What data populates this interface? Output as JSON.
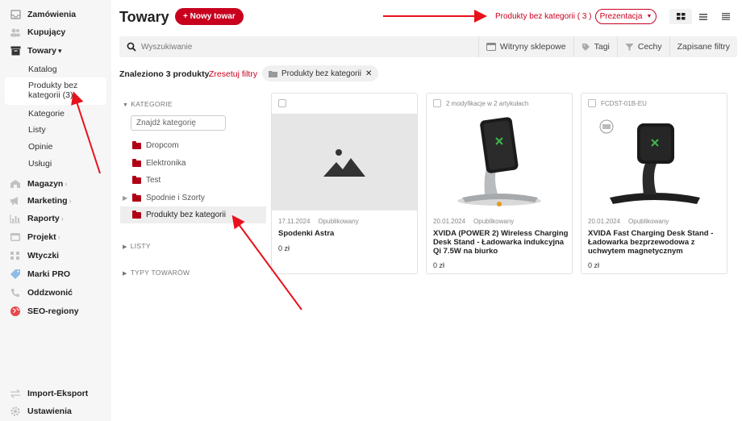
{
  "sidebar": {
    "items": [
      {
        "key": "orders",
        "label": "Zamówienia",
        "icon": "inbox-icon",
        "chevron": ""
      },
      {
        "key": "buyers",
        "label": "Kupujący",
        "icon": "users-icon",
        "chevron": ""
      },
      {
        "key": "products",
        "label": "Towary",
        "icon": "archive-icon",
        "chevron": "▾"
      },
      {
        "key": "warehouse",
        "label": "Magazyn",
        "icon": "warehouse-icon",
        "chevron": "›"
      },
      {
        "key": "marketing",
        "label": "Marketing",
        "icon": "megaphone-icon",
        "chevron": "›"
      },
      {
        "key": "reports",
        "label": "Raporty",
        "icon": "chart-icon",
        "chevron": "›"
      },
      {
        "key": "project",
        "label": "Projekt",
        "icon": "layout-icon",
        "chevron": "›"
      },
      {
        "key": "plugins",
        "label": "Wtyczki",
        "icon": "plugins-icon",
        "chevron": ""
      },
      {
        "key": "brands",
        "label": "Marki PRO",
        "icon": "tag-icon",
        "chevron": ""
      },
      {
        "key": "callback",
        "label": "Oddzwonić",
        "icon": "phone-icon",
        "chevron": ""
      },
      {
        "key": "seo",
        "label": "SEO-regiony",
        "icon": "globe-icon",
        "chevron": ""
      }
    ],
    "sub_items": [
      "Katalog",
      "Produkty bez kategorii (3)",
      "Kategorie",
      "Listy",
      "Opinie",
      "Usługi"
    ],
    "bottom": [
      {
        "label": "Import-Eksport",
        "icon": "transfer-icon"
      },
      {
        "label": "Ustawienia",
        "icon": "gear-icon"
      }
    ]
  },
  "header": {
    "title": "Towary",
    "new_button": "+ Nowy towar",
    "uncategorized_link": "Produkty bez kategorii ( 3 )",
    "presentation_button": "Prezentacja"
  },
  "search": {
    "placeholder": "Wyszukiwanie",
    "filters": [
      "Witryny sklepowe",
      "Tagi",
      "Cechy",
      "Zapisane filtry"
    ]
  },
  "results": {
    "found": "Znaleziono 3 produkty.",
    "reset": "Zresetuj filtry",
    "chip": "Produkty bez kategorii"
  },
  "categories": {
    "heading": "KATEGORIE",
    "search_placeholder": "Znajdź kategorię",
    "items": [
      "Dropcom",
      "Elektronika",
      "Test",
      "Spodnie i Szorty",
      "Produkty bez kategorii"
    ],
    "lists_heading": "LISTY",
    "types_heading": "TYPY TOWARÓW"
  },
  "products": [
    {
      "top": "",
      "date": "17.11.2024",
      "status": "Opublikowany",
      "name": "Spodenki Astra",
      "price": "0 zł"
    },
    {
      "top": "2 modyfikacje w 2 artykułach",
      "date": "20.01.2024",
      "status": "Opublikowany",
      "name": "XVIDA (POWER 2) Wireless Charging Desk Stand - Ładowarka indukcyjna Qi 7.5W na biurko",
      "price": "0 zł"
    },
    {
      "top": "FCDST-01B-EU",
      "date": "20.01.2024",
      "status": "Opublikowany",
      "name": "XVIDA Fast Charging Desk Stand - Ładowarka bezprzewodowa z uchwytem magnetycznym",
      "price": "0 zł"
    }
  ],
  "colors": {
    "accent": "#c8001e",
    "folder": "#b00016"
  }
}
